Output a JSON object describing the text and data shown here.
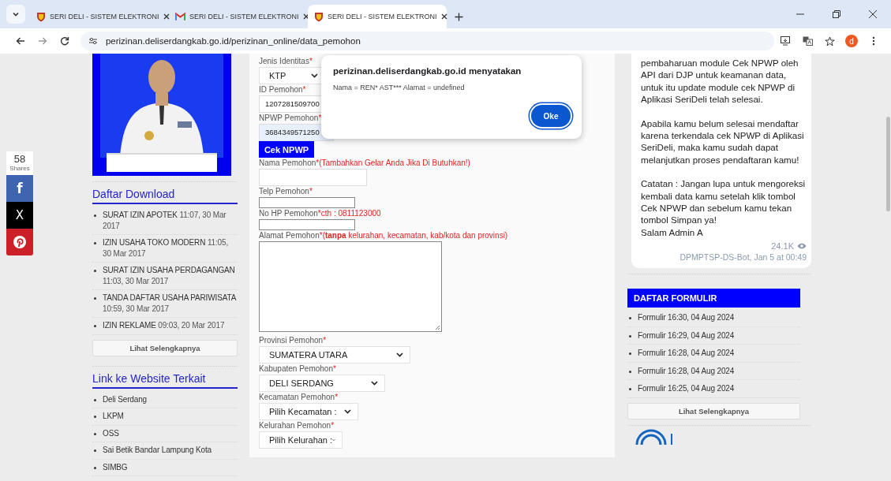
{
  "browser": {
    "tabs": [
      {
        "title": "SERI DELI - SISTEM ELEKTRONI",
        "kind": "shield",
        "selected": false
      },
      {
        "title": "SERI DELI - SISTEM ELEKTRONI",
        "kind": "mail",
        "selected": false
      },
      {
        "title": "SERI DELI - SISTEM ELEKTRONI",
        "kind": "shield",
        "selected": true
      }
    ],
    "url": "perizinan.deliserdangkab.go.id/perizinan_online/data_pemohon",
    "profile_initial": "d"
  },
  "share_bar": {
    "count": "58",
    "label": "Shares",
    "buttons": [
      {
        "kind": "facebook",
        "glyph": "f"
      },
      {
        "kind": "x",
        "glyph": "X"
      },
      {
        "kind": "pinterest"
      }
    ]
  },
  "downloads": {
    "title": "Daftar Download",
    "items": [
      {
        "title": "SURAT IZIN APOTEK",
        "date": "11:07, 30 Mar 2017"
      },
      {
        "title": "IZIN USAHA TOKO MODERN",
        "date": "11:05, 30 Mar 2017"
      },
      {
        "title": "SURAT IZIN USAHA PERDAGANGAN",
        "date": "11:03, 30 Mar 2017"
      },
      {
        "title": "TANDA DAFTAR USAHA PARIWISATA",
        "date": "10:59, 30 Mar 2017"
      },
      {
        "title": "IZIN REKLAME",
        "date": "09:03, 20 Mar 2017"
      }
    ],
    "more": "Lihat Selengkapnya"
  },
  "links": {
    "title": "Link ke Website Terkait",
    "items": [
      "Deli Serdang",
      "LKPM",
      "OSS",
      "Sai Betik Bandar Lampung Kota",
      "SIMBG"
    ]
  },
  "form": [
    {
      "kind": "label",
      "text": "Jenis Identitas",
      "mark": "*"
    },
    {
      "kind": "select",
      "value": "KTP"
    },
    {
      "kind": "label",
      "text": "ID Pemohon",
      "mark": "*"
    },
    {
      "kind": "input",
      "value": "1207281509700"
    },
    {
      "kind": "label",
      "text": "NPWP Pemohon",
      "mark": "*"
    },
    {
      "kind": "input",
      "value": "3684349571250",
      "autofilled": true
    },
    {
      "kind": "button",
      "value": "Cek NPWP"
    },
    {
      "kind": "label",
      "text": "Nama Pemohon",
      "mark": "*",
      "hint": "(Tambahkan Gelar Anda Jika Di Butuhkan!)"
    },
    {
      "kind": "input"
    },
    {
      "kind": "label",
      "text": "Telp Pemohon",
      "mark": "*"
    },
    {
      "kind": "input"
    },
    {
      "kind": "label",
      "text": "No HP Pemohon",
      "mark": "*",
      "hint": "cth : 0811123000"
    },
    {
      "kind": "input"
    },
    {
      "kind": "label",
      "text": "Alamat Pemohon",
      "mark": "*",
      "hint": "(**tanpa** kelurahan, kecamatan, kab/kota dan provinsi)"
    },
    {
      "kind": "textarea"
    },
    {
      "kind": "label",
      "text": "Provinsi Pemohon",
      "mark": "*"
    },
    {
      "kind": "select",
      "value": "SUMATERA UTARA"
    },
    {
      "kind": "label",
      "text": "Kabupaten Pemohon",
      "mark": "*"
    },
    {
      "kind": "select",
      "value": "DELI SERDANG"
    },
    {
      "kind": "label",
      "text": "Kecamatan Pemohon",
      "mark": "*"
    },
    {
      "kind": "select",
      "value": "Pilih Kecamatan :"
    },
    {
      "kind": "label",
      "text": "Kelurahan Pemohon",
      "mark": "*"
    },
    {
      "kind": "select",
      "value": "Pilih Kelurahan :"
    }
  ],
  "dialog": {
    "title": "perizinan.deliserdangkab.go.id menyatakan",
    "message": "Nama = REN* AST*** Alamat = undefined",
    "button": "Oke"
  },
  "message": {
    "paragraphs": [
      "pembaharuan module Cek NPWP oleh API dari DJP untuk keamanan data, untuk itu update module cek NPWP di Aplikasi SeriDeli telah selesai.",
      "Apabila kamu belum selesai mendaftar karena terkendala cek NPWP di Aplikasi SeriDeli, maka kamu sudah dapat melanjutkan proses pendaftaran kamu!",
      "Catatan : Jangan lupa untuk mengoreksi kembali data kamu setelah klik tombol Cek NPWP dan sebelum kamu tekan tombol Simpan ya!"
    ],
    "signature": "Salam Admin A",
    "views": "24.1K",
    "author": "DPMPTSP-DS-Bot, Jan 5 at 00:49"
  },
  "formulir": {
    "title": "DAFTAR FORMULIR",
    "items": [
      {
        "title": "Formulir",
        "date": "16:30, 04 Aug 2024"
      },
      {
        "title": "Formulir",
        "date": "16:29, 04 Aug 2024"
      },
      {
        "title": "Formulir",
        "date": "16:28, 04 Aug 2024"
      },
      {
        "title": "Formulir",
        "date": "16:28, 04 Aug 2024"
      },
      {
        "title": "Formulir",
        "date": "16:25, 04 Aug 2024"
      }
    ],
    "more": "Lihat Selengkapnya"
  }
}
